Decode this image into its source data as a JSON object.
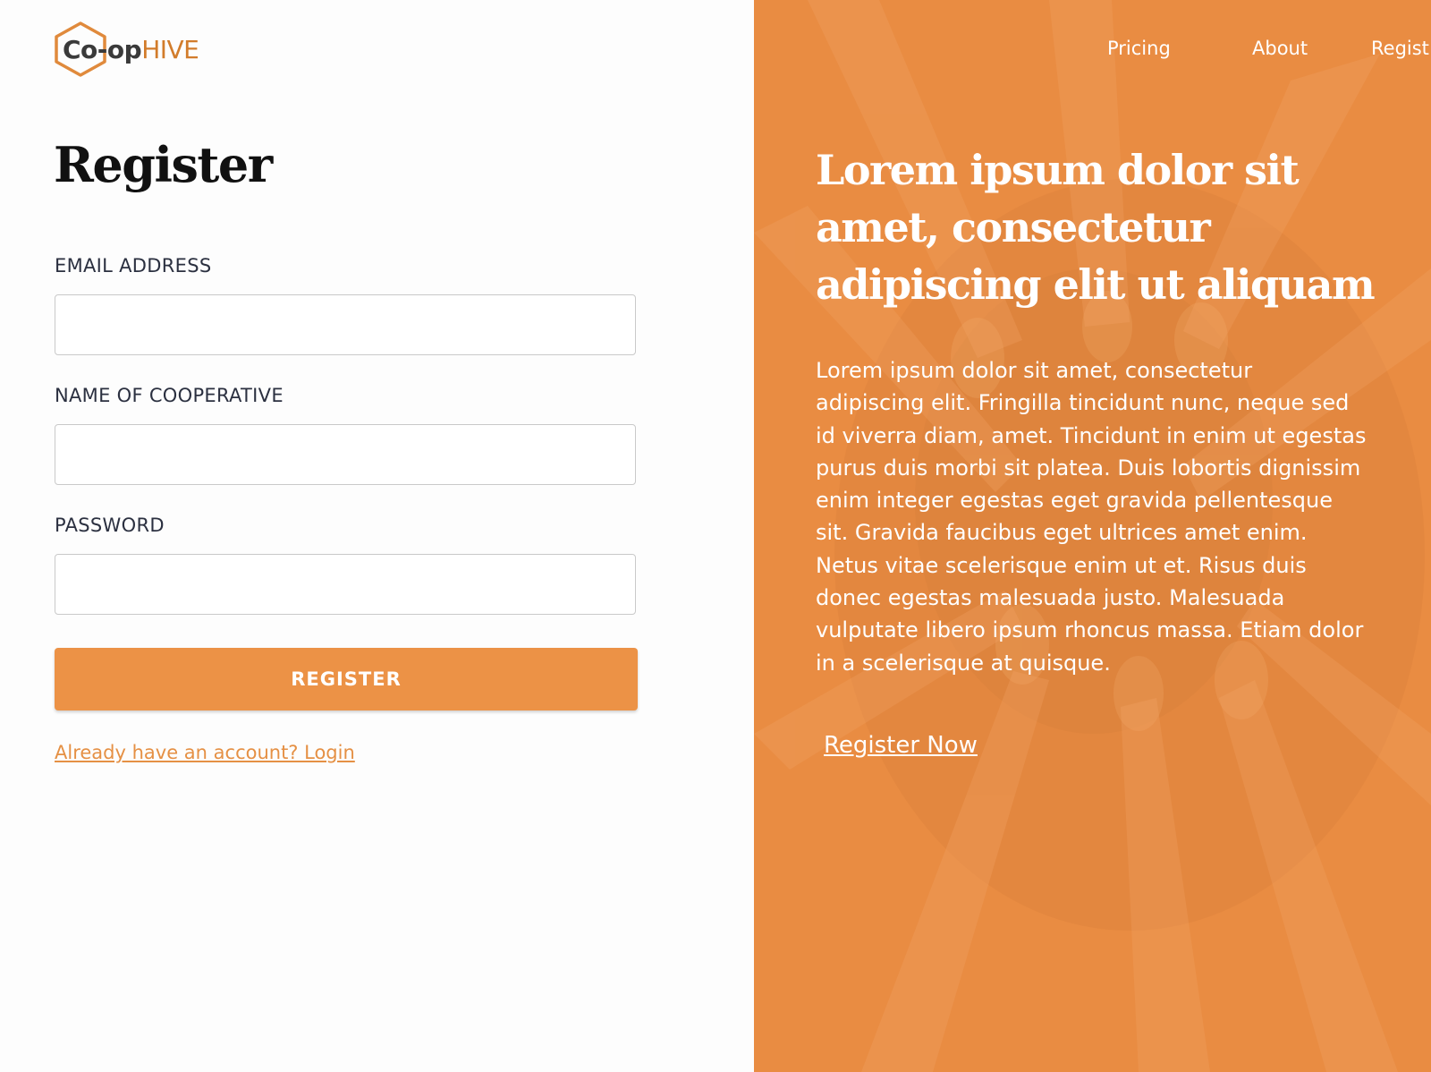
{
  "brand": {
    "logo_part1": "Co-op",
    "logo_part2": "HIVE"
  },
  "form": {
    "title": "Register",
    "fields": [
      {
        "label": "EMAIL ADDRESS",
        "value": "",
        "placeholder": ""
      },
      {
        "label": "NAME OF COOPERATIVE",
        "value": "",
        "placeholder": ""
      },
      {
        "label": "PASSWORD",
        "value": "",
        "placeholder": ""
      }
    ],
    "submit_label": "REGISTER",
    "login_link": "Already have an account? Login"
  },
  "nav": {
    "items": [
      "Pricing",
      "About",
      "Regist"
    ]
  },
  "hero": {
    "heading": "Lorem ipsum dolor sit amet, consectetur adipiscing elit ut aliquam",
    "body_lines": [
      "Lorem ipsum dolor sit amet, consectetur",
      "adipiscing elit. Fringilla tincidunt nunc, neque sed",
      "id viverra diam, amet. Tincidunt in enim ut egestas",
      "purus duis morbi sit platea. Duis lobortis dignissim",
      "enim integer egestas eget gravida pellentesque",
      "sit. Gravida faucibus eget ultrices amet enim.",
      "Netus vitae scelerisque enim ut et. Risus duis",
      "donec egestas malesuada justo. Malesuada",
      "vulputate libero ipsum rhoncus massa. Etiam dolor",
      "in a scelerisque at quisque."
    ],
    "cta_label": "Register Now"
  },
  "colors": {
    "accent": "#ec9246",
    "link": "#e59044",
    "logo_hive": "#d27c2b",
    "hero_overlay": "#e98c42"
  }
}
